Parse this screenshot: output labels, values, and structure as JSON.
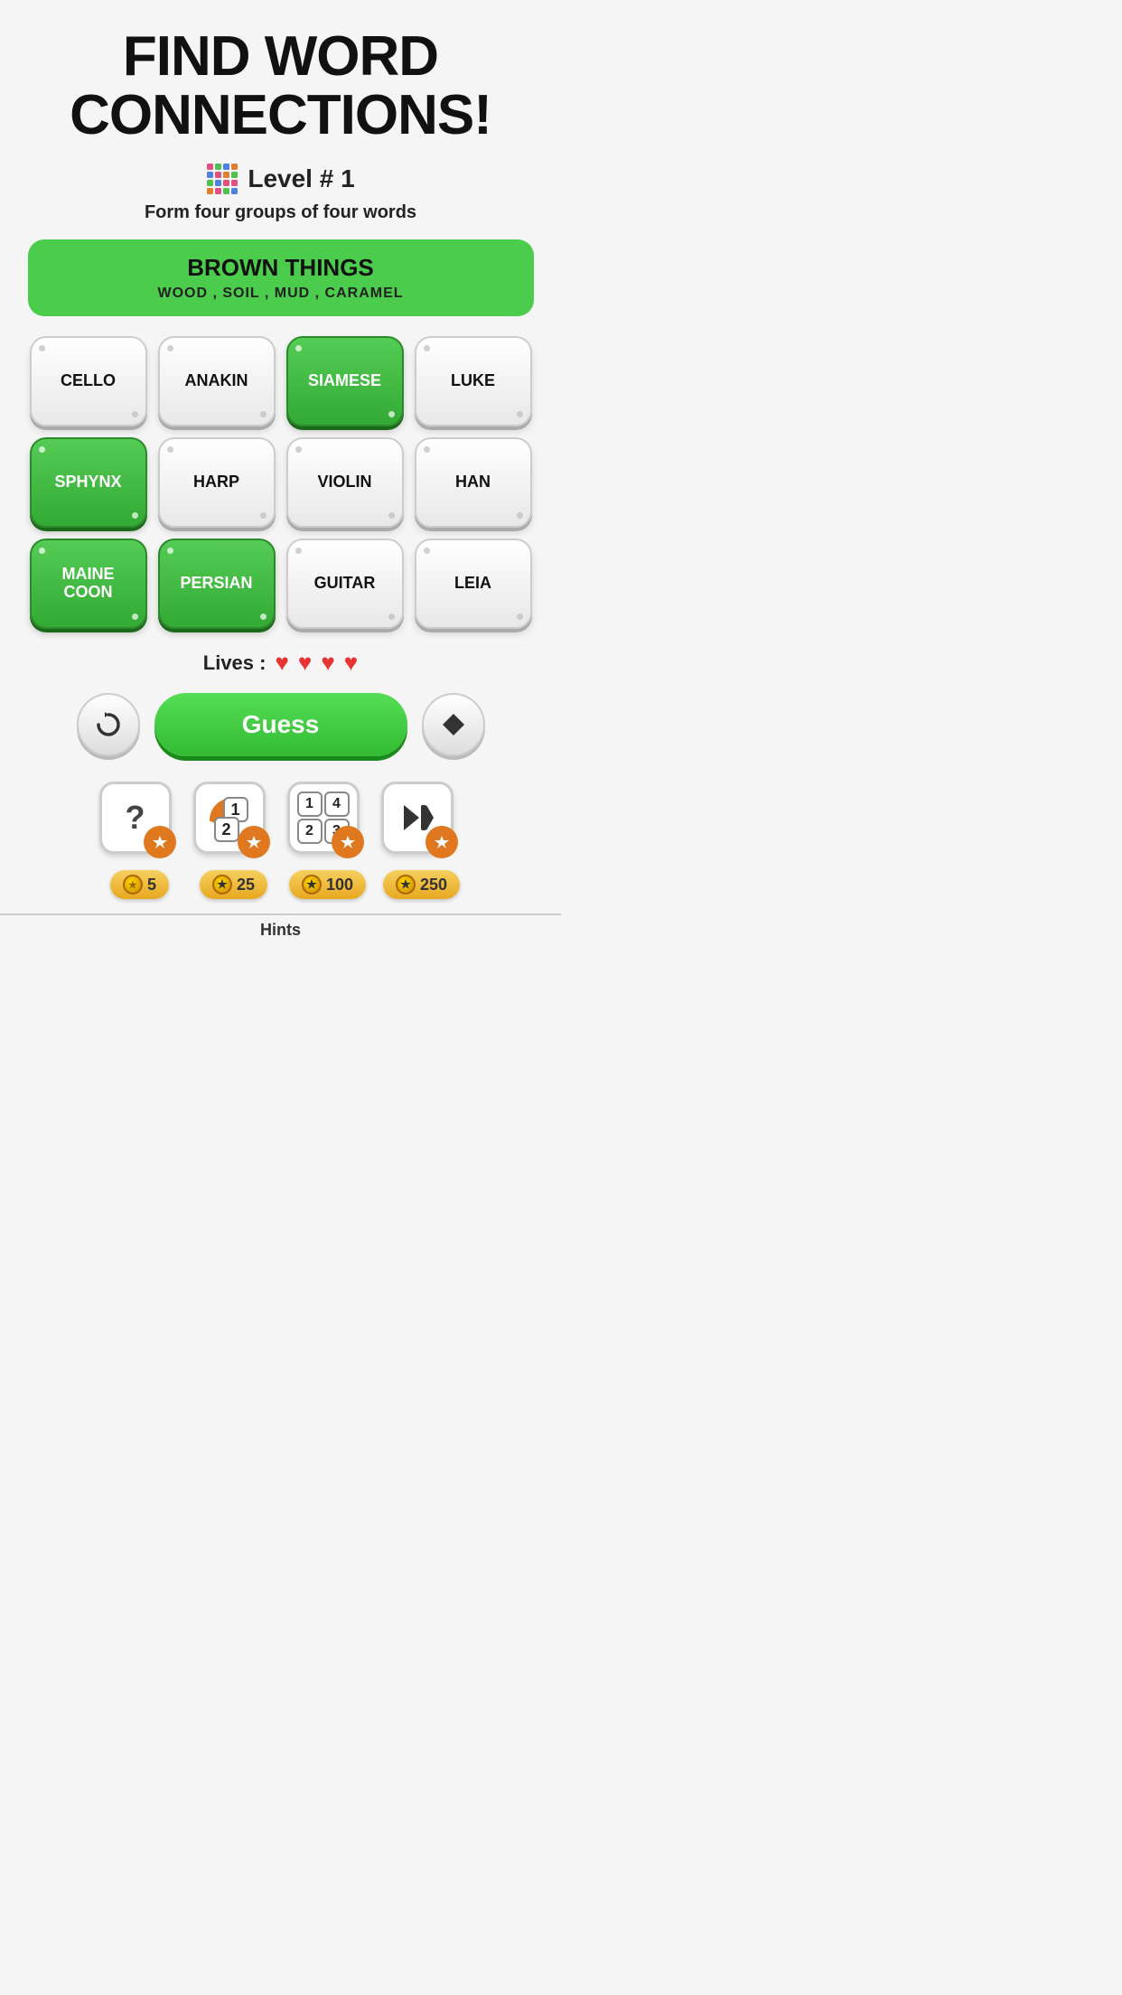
{
  "header": {
    "title_line1": "FIND WORD",
    "title_line2": "CONNECTIONS!"
  },
  "level": {
    "label": "Level # 1",
    "icon_alt": "grid-icon"
  },
  "subtitle": "Form four groups of four words",
  "category_banner": {
    "title": "BROWN THINGS",
    "words": "WOOD , SOIL , MUD , CARAMEL"
  },
  "tiles": [
    {
      "word": "CELLO",
      "selected": false,
      "id": "cello"
    },
    {
      "word": "ANAKIN",
      "selected": false,
      "id": "anakin"
    },
    {
      "word": "SIAMESE",
      "selected": true,
      "id": "siamese"
    },
    {
      "word": "LUKE",
      "selected": false,
      "id": "luke"
    },
    {
      "word": "SPHYNX",
      "selected": true,
      "id": "sphynx"
    },
    {
      "word": "HARP",
      "selected": false,
      "id": "harp"
    },
    {
      "word": "VIOLIN",
      "selected": false,
      "id": "violin"
    },
    {
      "word": "HAN",
      "selected": false,
      "id": "han"
    },
    {
      "word": "MAINE\nCOON",
      "selected": true,
      "id": "maine-coon"
    },
    {
      "word": "PERSIAN",
      "selected": true,
      "id": "persian"
    },
    {
      "word": "GUITAR",
      "selected": false,
      "id": "guitar"
    },
    {
      "word": "LEIA",
      "selected": false,
      "id": "leia"
    }
  ],
  "lives": {
    "label": "Lives :",
    "count": 4
  },
  "buttons": {
    "shuffle_label": "↺",
    "guess_label": "Guess",
    "erase_label": "◆"
  },
  "hints": [
    {
      "type": "question",
      "cost": "5",
      "id": "hint-question"
    },
    {
      "type": "numbers-12",
      "cost": "25",
      "id": "hint-reveal"
    },
    {
      "type": "numbers-123",
      "cost": "100",
      "id": "hint-solve"
    },
    {
      "type": "play",
      "cost": "250",
      "id": "hint-auto"
    }
  ],
  "hints_label": "Hints"
}
